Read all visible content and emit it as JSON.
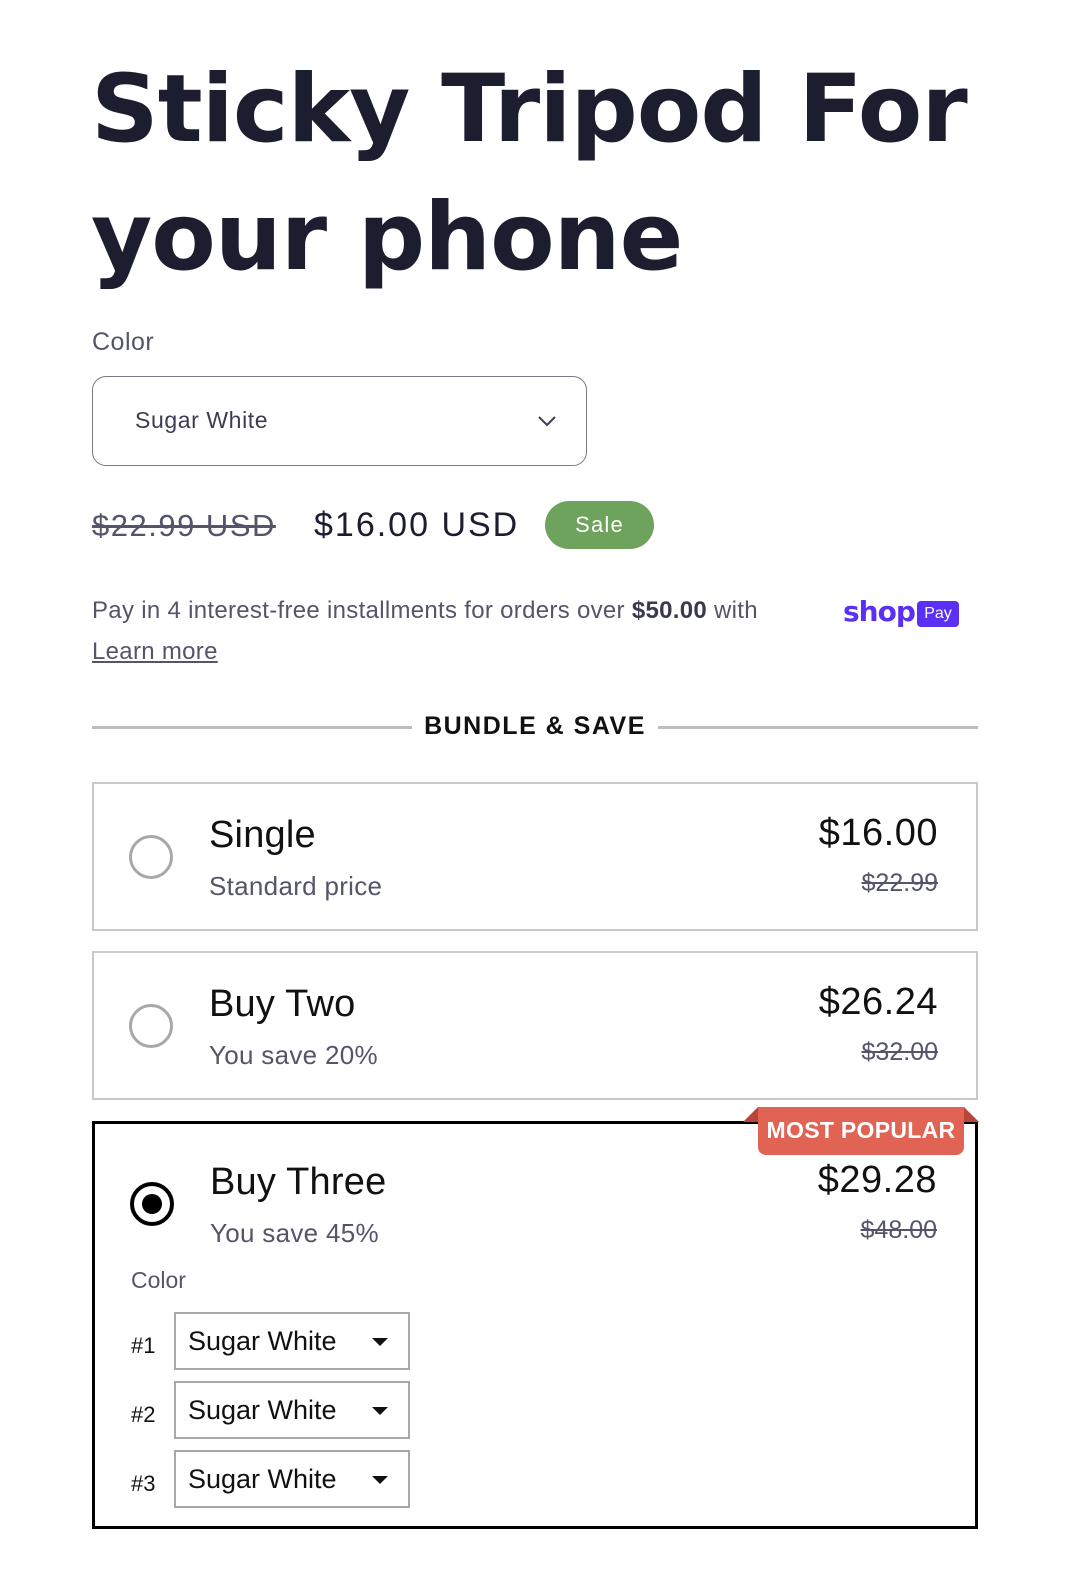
{
  "product": {
    "title": "Sticky Tripod For your phone",
    "color_label": "Color",
    "color_selected": "Sugar White"
  },
  "pricing": {
    "compare_at": "$22.99 USD",
    "price": "$16.00 USD",
    "sale_badge": "Sale"
  },
  "installments": {
    "text_before": "Pay in 4 interest-free installments for orders over ",
    "threshold": "$50.00",
    "text_after": " with ",
    "shop_word": "shop",
    "pay_word": "Pay",
    "learn_more": "Learn more"
  },
  "bundle": {
    "heading": "BUNDLE & SAVE",
    "options": [
      {
        "title": "Single",
        "subtitle": "Standard price",
        "price": "$16.00",
        "compare": "$22.99",
        "selected": false
      },
      {
        "title": "Buy Two",
        "subtitle": "You save 20%",
        "price": "$26.24",
        "compare": "$32.00",
        "selected": false
      },
      {
        "title": "Buy Three",
        "subtitle": "You save 45%",
        "price": "$29.28",
        "compare": "$48.00",
        "selected": true,
        "badge": "MOST POPULAR"
      }
    ],
    "variant_color_label": "Color",
    "variant_pickers": [
      {
        "label": "#1",
        "value": "Sugar White"
      },
      {
        "label": "#2",
        "value": "Sugar White"
      },
      {
        "label": "#3",
        "value": "Sugar White"
      }
    ]
  },
  "colors": {
    "sale_green": "#6da35d",
    "badge_red": "#e06354",
    "shop_pay_purple": "#5a31f4",
    "heading_navy": "#1d1d30"
  }
}
